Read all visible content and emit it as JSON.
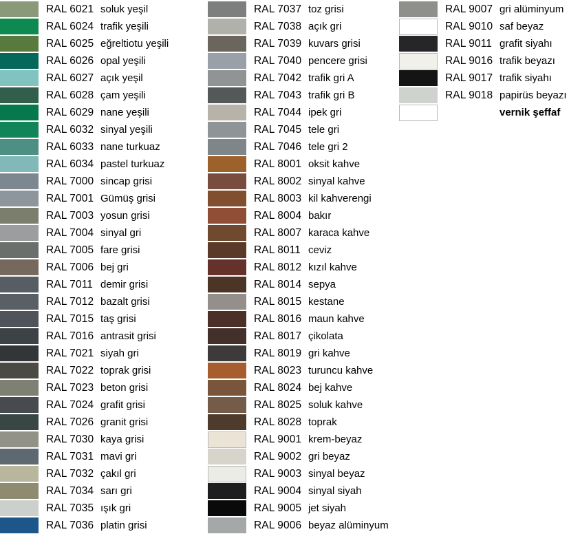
{
  "columns": [
    {
      "rows": [
        {
          "code": "RAL 6021",
          "name": "soluk yeşil",
          "color": "#8a9977"
        },
        {
          "code": "RAL 6024",
          "name": "trafik yeşili",
          "color": "#0e8a50"
        },
        {
          "code": "RAL 6025",
          "name": "eğreltiotu yeşili",
          "color": "#587a3e"
        },
        {
          "code": "RAL 6026",
          "name": "opal yeşili",
          "color": "#04695a"
        },
        {
          "code": "RAL 6027",
          "name": "açık yeşil",
          "color": "#80c3bf"
        },
        {
          "code": "RAL 6028",
          "name": "çam yeşili",
          "color": "#325f4d"
        },
        {
          "code": "RAL 6029",
          "name": "nane yeşili",
          "color": "#06784d"
        },
        {
          "code": "RAL 6032",
          "name": "sinyal yeşili",
          "color": "#12845a"
        },
        {
          "code": "RAL 6033",
          "name": "nane turkuaz",
          "color": "#4d8f82"
        },
        {
          "code": "RAL 6034",
          "name": "pastel turkuaz",
          "color": "#82b8b8"
        },
        {
          "code": "RAL 7000",
          "name": "sincap grisi",
          "color": "#7c8790"
        },
        {
          "code": "RAL 7001",
          "name": "Gümüş grisi",
          "color": "#8c969c"
        },
        {
          "code": "RAL 7003",
          "name": "yosun grisi",
          "color": "#7b7e6d"
        },
        {
          "code": "RAL 7004",
          "name": "sinyal gri",
          "color": "#9c9d9f"
        },
        {
          "code": "RAL 7005",
          "name": "fare grisi",
          "color": "#6b6f6b"
        },
        {
          "code": "RAL 7006",
          "name": "bej gri",
          "color": "#75695d"
        },
        {
          "code": "RAL 7011",
          "name": "demir grisi",
          "color": "#565d63"
        },
        {
          "code": "RAL 7012",
          "name": "bazalt grisi",
          "color": "#596065"
        },
        {
          "code": "RAL 7015",
          "name": "taş grisi",
          "color": "#50545a"
        },
        {
          "code": "RAL 7016",
          "name": "antrasit grisi",
          "color": "#3d4247"
        },
        {
          "code": "RAL 7021",
          "name": "siyah gri",
          "color": "#333637"
        },
        {
          "code": "RAL 7022",
          "name": "toprak grisi",
          "color": "#4c4a44"
        },
        {
          "code": "RAL 7023",
          "name": "beton grisi",
          "color": "#7f8074"
        },
        {
          "code": "RAL 7024",
          "name": "grafit grisi",
          "color": "#474b50"
        },
        {
          "code": "RAL 7026",
          "name": "granit grisi",
          "color": "#384644"
        },
        {
          "code": "RAL 7030",
          "name": "kaya grisi",
          "color": "#939288"
        },
        {
          "code": "RAL 7031",
          "name": "mavi gri",
          "color": "#5d6870"
        },
        {
          "code": "RAL 7032",
          "name": "çakıl gri",
          "color": "#b8b79e"
        },
        {
          "code": "RAL 7034",
          "name": "sarı gri",
          "color": "#8f8b70"
        },
        {
          "code": "RAL 7035",
          "name": "ışık gri",
          "color": "#cbd0cc"
        },
        {
          "code": "RAL 7036",
          "name": "platin grisi",
          "color": "#1d5688"
        }
      ]
    },
    {
      "rows": [
        {
          "code": "RAL 7037",
          "name": "toz grisi",
          "color": "#7d7f7e"
        },
        {
          "code": "RAL 7038",
          "name": "açık gri",
          "color": "#b0b1aa"
        },
        {
          "code": "RAL 7039",
          "name": "kuvars grisi",
          "color": "#6a665e"
        },
        {
          "code": "RAL 7040",
          "name": "pencere grisi",
          "color": "#9aa0a7"
        },
        {
          "code": "RAL 7042",
          "name": "trafik gri A",
          "color": "#909495"
        },
        {
          "code": "RAL 7043",
          "name": "trafik gri B",
          "color": "#555859"
        },
        {
          "code": "RAL 7044",
          "name": "ipek gri",
          "color": "#b7b3a8"
        },
        {
          "code": "RAL 7045",
          "name": "tele gri",
          "color": "#8f9597"
        },
        {
          "code": "RAL 7046",
          "name": "tele gri 2",
          "color": "#7f868a"
        },
        {
          "code": "RAL 8001",
          "name": "oksit kahve",
          "color": "#9d622b"
        },
        {
          "code": "RAL 8002",
          "name": "sinyal kahve",
          "color": "#794d3e"
        },
        {
          "code": "RAL 8003",
          "name": "kil kahverengi",
          "color": "#7f4f2e"
        },
        {
          "code": "RAL 8004",
          "name": "bakır",
          "color": "#8f4e35"
        },
        {
          "code": "RAL 8007",
          "name": "karaca kahve",
          "color": "#6f4a2f"
        },
        {
          "code": "RAL 8011",
          "name": "ceviz",
          "color": "#5b3a29"
        },
        {
          "code": "RAL 8012",
          "name": "kızıl kahve",
          "color": "#64312b"
        },
        {
          "code": "RAL 8014",
          "name": "sepya",
          "color": "#4a3526"
        },
        {
          "code": "RAL 8015",
          "name": "kestane",
          "color": "#948f8a"
        },
        {
          "code": "RAL 8016",
          "name": "maun kahve",
          "color": "#4c2f26"
        },
        {
          "code": "RAL 8017",
          "name": "çikolata",
          "color": "#44302a"
        },
        {
          "code": "RAL 8019",
          "name": "gri kahve",
          "color": "#3f3a3a"
        },
        {
          "code": "RAL 8023",
          "name": "turuncu kahve",
          "color": "#a65e2e"
        },
        {
          "code": "RAL 8024",
          "name": "bej kahve",
          "color": "#79553c"
        },
        {
          "code": "RAL 8025",
          "name": "soluk kahve",
          "color": "#755c49"
        },
        {
          "code": "RAL 8028",
          "name": "toprak",
          "color": "#4e3b2b"
        },
        {
          "code": "RAL 9001",
          "name": "krem-beyaz",
          "color": "#ebe3d6"
        },
        {
          "code": "RAL 9002",
          "name": "gri beyaz",
          "color": "#d7d5cb"
        },
        {
          "code": "RAL 9003",
          "name": "sinyal beyaz",
          "color": "#ecece7"
        },
        {
          "code": "RAL 9004",
          "name": "sinyal siyah",
          "color": "#1e1e1e"
        },
        {
          "code": "RAL 9005",
          "name": "jet siyah",
          "color": "#0a0a0a"
        },
        {
          "code": "RAL 9006",
          "name": "beyaz alüminyum",
          "color": "#a5a8a9"
        }
      ]
    },
    {
      "rows": [
        {
          "code": "RAL 9007",
          "name": "gri alüminyum",
          "color": "#8f8f8c"
        },
        {
          "code": "RAL 9010",
          "name": "saf beyaz",
          "color": "#ffffff"
        },
        {
          "code": "RAL 9011",
          "name": "grafit siyahı",
          "color": "#262628"
        },
        {
          "code": "RAL 9016",
          "name": "trafik beyazı",
          "color": "#f1f0ea"
        },
        {
          "code": "RAL 9017",
          "name": "trafik siyahı",
          "color": "#141414"
        },
        {
          "code": "RAL 9018",
          "name": "papirüs beyazı",
          "color": "#cfd3cd"
        },
        {
          "code": "",
          "name": "vernik şeffaf",
          "color": "#ffffff",
          "bold": true
        }
      ]
    }
  ]
}
